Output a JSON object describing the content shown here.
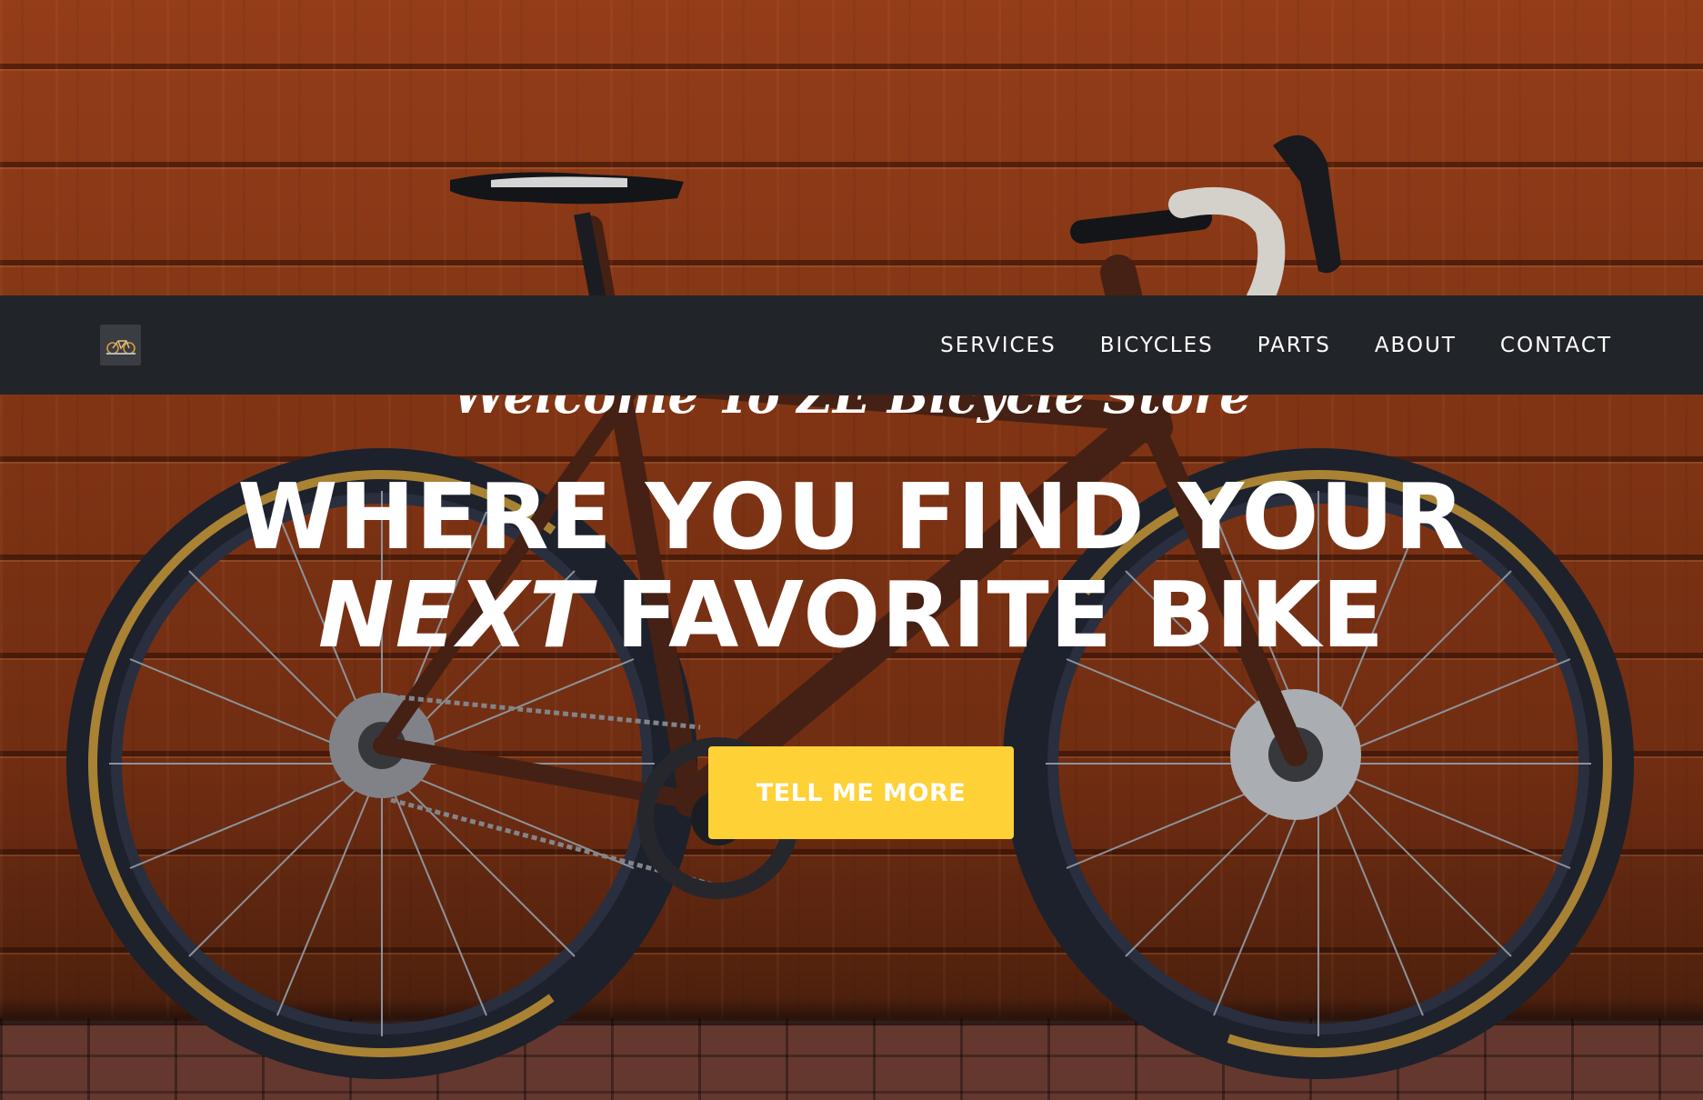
{
  "nav": {
    "brand_logo_icon": "bicycle-logo-icon",
    "links": [
      {
        "label": "SERVICES"
      },
      {
        "label": "BICYCLES"
      },
      {
        "label": "PARTS"
      },
      {
        "label": "ABOUT"
      },
      {
        "label": "CONTACT"
      }
    ]
  },
  "hero": {
    "subheading": "Welcome To ZE Bicycle Store",
    "heading_line1": "WHERE YOU FIND YOUR",
    "heading_emphasis": "NEXT",
    "heading_line2_rest": "FAVORITE BIKE",
    "cta_label": "TELL ME MORE",
    "background_image": "road-bicycle-against-wooden-wall"
  },
  "colors": {
    "navbar_bg": "#212529",
    "cta_bg": "#fed136",
    "text": "#ffffff",
    "wood": "#8d3a16"
  }
}
